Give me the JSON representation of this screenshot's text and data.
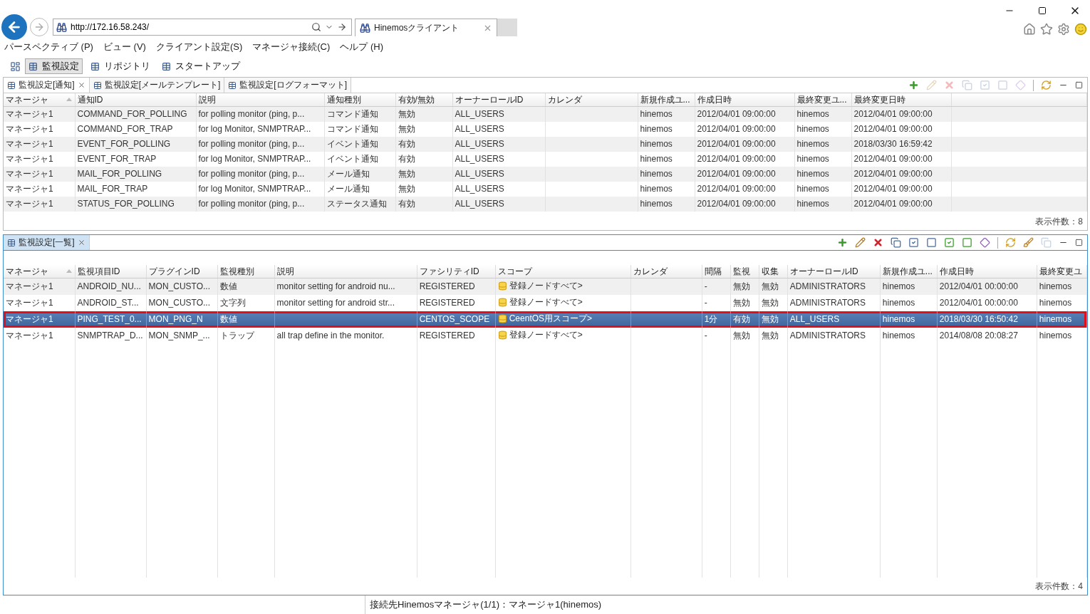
{
  "browser": {
    "address": "http://172.16.58.243/",
    "tabs": [
      {
        "title": "Hinemosクライアント",
        "selected": true
      }
    ]
  },
  "menu": [
    "パースペクティブ (P)",
    "ビュー (V)",
    "クライアント設定(S)",
    "マネージャ接続(C)",
    "ヘルプ (H)"
  ],
  "perspectives": [
    {
      "label": "監視設定",
      "selected": true
    },
    {
      "label": "リポジトリ",
      "selected": false
    },
    {
      "label": "スタートアップ",
      "selected": false
    }
  ],
  "views": [
    {
      "active": false,
      "tabs": [
        {
          "label": "監視設定[通知]",
          "selected": true
        },
        {
          "label": "監視設定[メールテンプレート]",
          "selected": false
        },
        {
          "label": "監視設定[ログフォーマット]",
          "selected": false
        }
      ],
      "toolbar": [
        {
          "kind": "add",
          "disabled": false
        },
        {
          "kind": "edit",
          "disabled": true
        },
        {
          "kind": "delete",
          "disabled": true
        },
        {
          "kind": "copy",
          "disabled": true
        },
        {
          "kind": "enable",
          "disabled": true
        },
        {
          "kind": "disable",
          "disabled": true
        },
        {
          "kind": "gem",
          "disabled": true
        },
        {
          "kind": "separator"
        },
        {
          "kind": "refresh",
          "disabled": false
        }
      ],
      "columns": [
        {
          "label": "マネージャ",
          "sorted": true,
          "kind": "text"
        },
        {
          "label": "通知ID",
          "sorted": false,
          "kind": "text"
        },
        {
          "label": "説明",
          "sorted": false,
          "kind": "text"
        },
        {
          "label": "通知種別",
          "sorted": false,
          "kind": "text"
        },
        {
          "label": "有効/無効",
          "sorted": false,
          "kind": "text"
        },
        {
          "label": "オーナーロールID",
          "sorted": false,
          "kind": "text"
        },
        {
          "label": "カレンダ",
          "sorted": false,
          "kind": "text"
        },
        {
          "label": "新規作成ユ...",
          "sorted": false,
          "kind": "text"
        },
        {
          "label": "作成日時",
          "sorted": false,
          "kind": "text"
        },
        {
          "label": "最終変更ユ...",
          "sorted": false,
          "kind": "text"
        },
        {
          "label": "最終変更日時",
          "sorted": false,
          "kind": "text"
        }
      ],
      "rows": [
        {
          "selected": false,
          "annotated": false,
          "cells": [
            "マネージャ1",
            "COMMAND_FOR_POLLING",
            "for polling monitor (ping, p...",
            "コマンド通知",
            "無効",
            "ALL_USERS",
            "",
            "hinemos",
            "2012/04/01 09:00:00",
            "hinemos",
            "2012/04/01 09:00:00"
          ]
        },
        {
          "selected": false,
          "annotated": false,
          "cells": [
            "マネージャ1",
            "COMMAND_FOR_TRAP",
            "for log Monitor, SNMPTRAP...",
            "コマンド通知",
            "無効",
            "ALL_USERS",
            "",
            "hinemos",
            "2012/04/01 09:00:00",
            "hinemos",
            "2012/04/01 09:00:00"
          ]
        },
        {
          "selected": false,
          "annotated": false,
          "cells": [
            "マネージャ1",
            "EVENT_FOR_POLLING",
            "for polling monitor (ping, p...",
            "イベント通知",
            "有効",
            "ALL_USERS",
            "",
            "hinemos",
            "2012/04/01 09:00:00",
            "hinemos",
            "2018/03/30 16:59:42"
          ]
        },
        {
          "selected": false,
          "annotated": false,
          "cells": [
            "マネージャ1",
            "EVENT_FOR_TRAP",
            "for log Monitor, SNMPTRAP...",
            "イベント通知",
            "有効",
            "ALL_USERS",
            "",
            "hinemos",
            "2012/04/01 09:00:00",
            "hinemos",
            "2012/04/01 09:00:00"
          ]
        },
        {
          "selected": false,
          "annotated": false,
          "cells": [
            "マネージャ1",
            "MAIL_FOR_POLLING",
            "for polling monitor (ping, p...",
            "メール通知",
            "無効",
            "ALL_USERS",
            "",
            "hinemos",
            "2012/04/01 09:00:00",
            "hinemos",
            "2012/04/01 09:00:00"
          ]
        },
        {
          "selected": false,
          "annotated": false,
          "cells": [
            "マネージャ1",
            "MAIL_FOR_TRAP",
            "for log Monitor, SNMPTRAP...",
            "メール通知",
            "無効",
            "ALL_USERS",
            "",
            "hinemos",
            "2012/04/01 09:00:00",
            "hinemos",
            "2012/04/01 09:00:00"
          ]
        },
        {
          "selected": false,
          "annotated": false,
          "cells": [
            "マネージャ1",
            "STATUS_FOR_POLLING",
            "for polling monitor (ping, p...",
            "ステータス通知",
            "有効",
            "ALL_USERS",
            "",
            "hinemos",
            "2012/04/01 09:00:00",
            "hinemos",
            "2012/04/01 09:00:00"
          ]
        }
      ],
      "count": "表示件数：8"
    },
    {
      "active": true,
      "tabs": [
        {
          "label": "監視設定[一覧]",
          "selected": true
        }
      ],
      "toolbar": [
        {
          "kind": "add",
          "disabled": false
        },
        {
          "kind": "edit",
          "disabled": false
        },
        {
          "kind": "delete",
          "disabled": false
        },
        {
          "kind": "copy",
          "disabled": false
        },
        {
          "kind": "enable",
          "disabled": false
        },
        {
          "kind": "disable",
          "disabled": false
        },
        {
          "kind": "collect-on",
          "disabled": false
        },
        {
          "kind": "collect-off",
          "disabled": false
        },
        {
          "kind": "gem",
          "disabled": false
        },
        {
          "kind": "separator"
        },
        {
          "kind": "refresh",
          "disabled": false
        },
        {
          "kind": "brush",
          "disabled": false
        },
        {
          "kind": "copy",
          "disabled": true
        }
      ],
      "columns": [
        {
          "label": "マネージャ",
          "sorted": true,
          "kind": "text"
        },
        {
          "label": "監視項目ID",
          "sorted": false,
          "kind": "text"
        },
        {
          "label": "プラグインID",
          "sorted": false,
          "kind": "text"
        },
        {
          "label": "監視種別",
          "sorted": false,
          "kind": "text"
        },
        {
          "label": "説明",
          "sorted": false,
          "kind": "text"
        },
        {
          "label": "ファシリティID",
          "sorted": false,
          "kind": "text"
        },
        {
          "label": "スコープ",
          "sorted": false,
          "kind": "scope"
        },
        {
          "label": "カレンダ",
          "sorted": false,
          "kind": "text"
        },
        {
          "label": "間隔",
          "sorted": false,
          "kind": "text"
        },
        {
          "label": "監視",
          "sorted": false,
          "kind": "text"
        },
        {
          "label": "収集",
          "sorted": false,
          "kind": "text"
        },
        {
          "label": "オーナーロールID",
          "sorted": false,
          "kind": "text"
        },
        {
          "label": "新規作成ユ...",
          "sorted": false,
          "kind": "text"
        },
        {
          "label": "作成日時",
          "sorted": false,
          "kind": "text"
        },
        {
          "label": "最終変更ユ",
          "sorted": false,
          "kind": "text"
        }
      ],
      "rows": [
        {
          "selected": false,
          "annotated": false,
          "cells": [
            "マネージャ1",
            "ANDROID_NU...",
            "MON_CUSTO...",
            "数値",
            "monitor setting for android nu...",
            "REGISTERED",
            "登録ノードすべて>",
            "",
            "-",
            "無効",
            "無効",
            "ADMINISTRATORS",
            "hinemos",
            "2012/04/01 00:00:00",
            "hinemos"
          ]
        },
        {
          "selected": false,
          "annotated": false,
          "cells": [
            "マネージャ1",
            "ANDROID_ST...",
            "MON_CUSTO...",
            "文字列",
            "monitor setting for android str...",
            "REGISTERED",
            "登録ノードすべて>",
            "",
            "-",
            "無効",
            "無効",
            "ADMINISTRATORS",
            "hinemos",
            "2012/04/01 00:00:00",
            "hinemos"
          ]
        },
        {
          "selected": true,
          "annotated": true,
          "cells": [
            "マネージャ1",
            "PING_TEST_0...",
            "MON_PNG_N",
            "数値",
            "",
            "CENTOS_SCOPE",
            "CeentOS用スコープ>",
            "",
            "1分",
            "有効",
            "無効",
            "ALL_USERS",
            "hinemos",
            "2018/03/30 16:50:42",
            "hinemos"
          ]
        },
        {
          "selected": false,
          "annotated": false,
          "cells": [
            "マネージャ1",
            "SNMPTRAP_D...",
            "MON_SNMP_...",
            "トラップ",
            "all trap define in the monitor.",
            "REGISTERED",
            "登録ノードすべて>",
            "",
            "-",
            "無効",
            "無効",
            "ADMINISTRATORS",
            "hinemos",
            "2014/08/08 20:08:27",
            "hinemos"
          ]
        }
      ],
      "count": "表示件数：4"
    }
  ],
  "status_bar": "接続先Hinemosマネージャ(1/1)：マネージャ1(hinemos)"
}
